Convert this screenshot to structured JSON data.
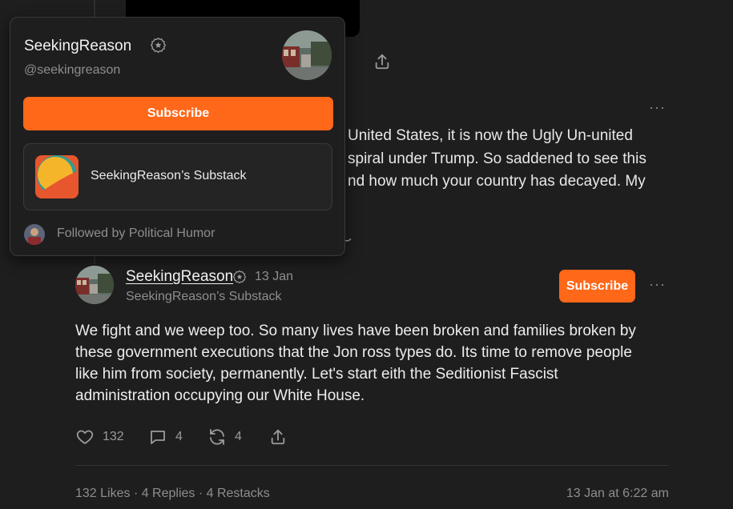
{
  "background_text": {
    "lines": [
      "United States, it is now the Ugly Un-united",
      "spiral under Trump. So saddened to see this",
      "nd how much your country has decayed. My"
    ],
    "peek_char": "k"
  },
  "popover": {
    "name": "SeekingReason",
    "handle": "@seekingreason",
    "subscribe_label": "Subscribe",
    "publication_name": "SeekingReason’s Substack",
    "followed_by": "Followed by Political Humor"
  },
  "reply": {
    "author": "SeekingReason",
    "date": "13 Jan",
    "publication": "SeekingReason’s Substack",
    "subscribe_label": "Subscribe",
    "more_label": "···",
    "body_lines": [
      "We fight and we weep too. So many lives have been broken and families broken by",
      "these government executions that the Jon ross types do. Its time to remove people",
      "like him from society, permanently. Let's start eith the Seditionist Fascist",
      "administration occupying our White House."
    ],
    "actions": {
      "likes": "132",
      "comments": "4",
      "restacks": "4"
    },
    "stats": "132 Likes · 4 Replies · 4 Restacks",
    "timestamp": "13 Jan at 6:22 am"
  },
  "icons": {
    "verified": "verified-badge-icon",
    "like": "heart-icon",
    "comment": "comment-icon",
    "restack": "restack-icon",
    "share": "share-icon",
    "more": "more-dots-icon"
  },
  "colors": {
    "accent": "#ff6719",
    "background": "#1e1e1e",
    "muted_text": "#8e8e8e"
  }
}
